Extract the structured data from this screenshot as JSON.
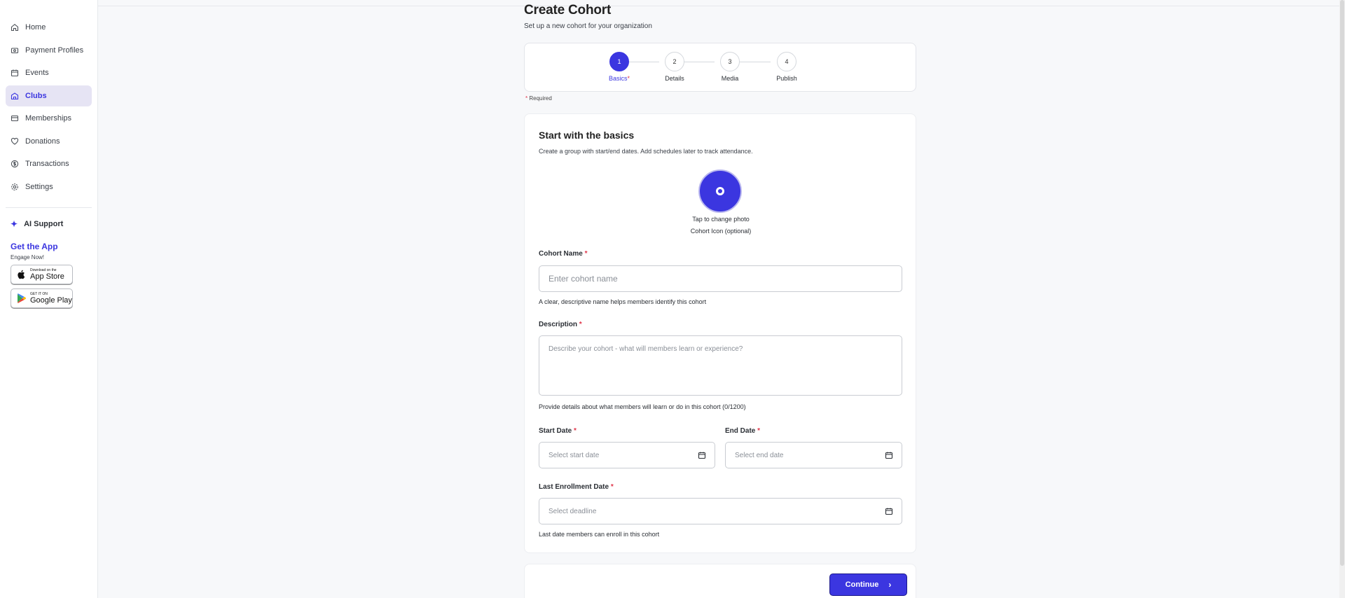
{
  "sidebar": {
    "items": [
      {
        "label": "Home",
        "icon": "home-icon"
      },
      {
        "label": "Payment Profiles",
        "icon": "payment-icon"
      },
      {
        "label": "Events",
        "icon": "calendar-icon"
      },
      {
        "label": "Clubs",
        "icon": "clubs-icon",
        "active": true
      },
      {
        "label": "Memberships",
        "icon": "membership-card-icon"
      },
      {
        "label": "Donations",
        "icon": "heart-icon"
      },
      {
        "label": "Transactions",
        "icon": "dollar-icon"
      },
      {
        "label": "Settings",
        "icon": "gear-icon"
      }
    ],
    "ai_support": "AI Support",
    "get_app": {
      "title": "Get the App",
      "subtitle": "Engage Now!",
      "app_store": {
        "small": "Download on the",
        "big": "App Store"
      },
      "google_play": {
        "small": "GET IT ON",
        "big": "Google Play"
      }
    }
  },
  "header": {
    "title": "Create Cohort",
    "subtitle": "Set up a new cohort for your organization"
  },
  "stepper": {
    "steps": [
      {
        "number": "1",
        "label": "Basics",
        "required": "*"
      },
      {
        "number": "2",
        "label": "Details"
      },
      {
        "number": "3",
        "label": "Media"
      },
      {
        "number": "4",
        "label": "Publish"
      }
    ],
    "required_note": "Required",
    "required_mark": "*"
  },
  "form": {
    "heading": "Start with the basics",
    "description": "Create a group with start/end dates. Add schedules later to track attendance.",
    "photo": {
      "tap": "Tap to change photo",
      "label": "Cohort Icon (optional)"
    },
    "cohort_name": {
      "label": "Cohort Name",
      "placeholder": "Enter cohort name",
      "help": "A clear, descriptive name helps members identify this cohort"
    },
    "description_field": {
      "label": "Description",
      "placeholder": "Describe your cohort - what will members learn or experience?",
      "help": "Provide details about what members will learn or do in this cohort (0/1200)"
    },
    "start_date": {
      "label": "Start Date",
      "placeholder": "Select start date"
    },
    "end_date": {
      "label": "End Date",
      "placeholder": "Select end date"
    },
    "last_enrollment": {
      "label": "Last Enrollment Date",
      "placeholder": "Select deadline",
      "help": "Last date members can enroll in this cohort"
    }
  },
  "footer": {
    "continue": "Continue"
  },
  "colors": {
    "accent": "#3b36e0",
    "required": "#e0364a"
  }
}
